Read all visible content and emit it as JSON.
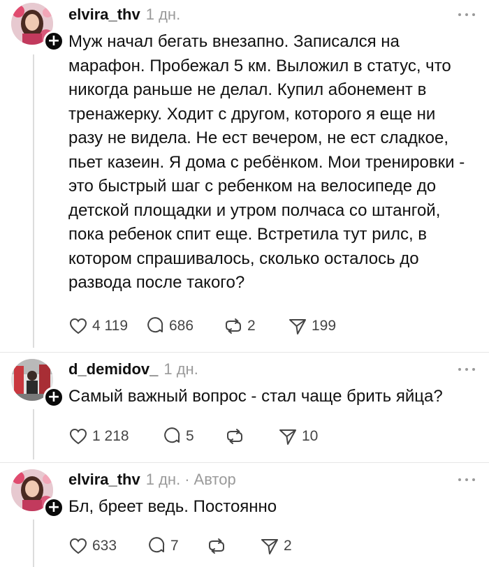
{
  "posts": [
    {
      "username": "elvira_thv",
      "time": "1 дн.",
      "text": "Муж начал бегать внезапно. Записался на марафон. Пробежал 5 км. Выложил в статус, что никогда раньше не делал. Купил абонемент в тренажерку. Ходит с другом, которого я еще ни разу не видела. Не ест вечером, не ест сладкое, пьет казеин. Я дома с ребёнком. Мои тренировки - это быстрый шаг с ребенком на велосипеде до детской площадки и утром полчаса со штангой, пока ребенок спит еще. Встретила тут рилс, в котором спрашивалось, сколько осталось до развода после такого?",
      "likes": "4 119",
      "comments": "686",
      "reposts": "2",
      "shares": "199"
    },
    {
      "username": "d_demidov_",
      "time": "1 дн.",
      "text": "Самый важный вопрос - стал чаще брить яйца?",
      "likes": "1 218",
      "comments": "5",
      "reposts": "",
      "shares": "10"
    },
    {
      "username": "elvira_thv",
      "time": "1 дн.",
      "separator": "·",
      "author_label": "Автор",
      "text": "Бл, бреет ведь. Постоянно",
      "likes": "633",
      "comments": "7",
      "reposts": "",
      "shares": "2"
    }
  ],
  "icons": {
    "like": "heart-icon",
    "comment": "comment-icon",
    "repost": "repost-icon",
    "share": "share-icon",
    "follow": "plus-icon",
    "more": "more-icon"
  },
  "colors": {
    "text": "#101010",
    "muted": "#9a9a9a",
    "divider": "#e6e6e6"
  }
}
